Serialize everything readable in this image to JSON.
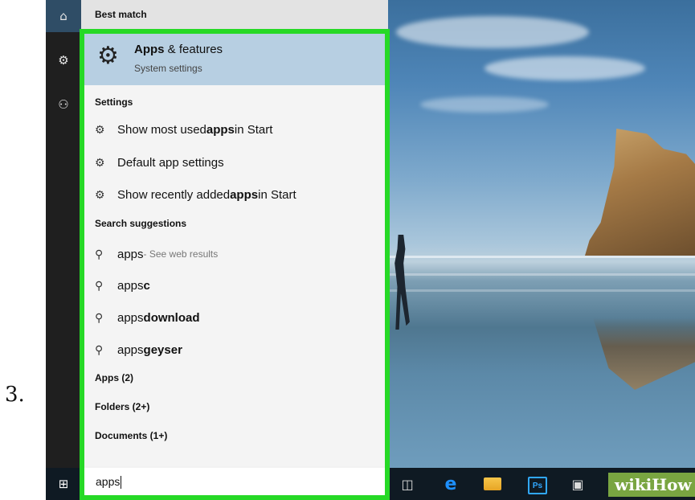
{
  "step_number": "3.",
  "panel": {
    "best_match_label": "Best match",
    "best": {
      "title_strong": "Apps",
      "title_rest": " & features",
      "subtitle": "System settings",
      "icon": "gear-icon"
    },
    "settings_label": "Settings",
    "settings_items": [
      {
        "pre": "Show most used ",
        "strong": "apps",
        "post": " in Start"
      },
      {
        "pre": "Default app settings",
        "strong": "",
        "post": ""
      },
      {
        "pre": "Show recently added ",
        "strong": "apps",
        "post": " in Start"
      }
    ],
    "suggestions_label": "Search suggestions",
    "suggestions": [
      {
        "pre": "apps",
        "strong": "",
        "hint": " - See web results"
      },
      {
        "pre": "apps",
        "strong": "c",
        "hint": ""
      },
      {
        "pre": "apps ",
        "strong": "download",
        "hint": ""
      },
      {
        "pre": "apps",
        "strong": "geyser",
        "hint": ""
      }
    ],
    "apps_label": "Apps (2)",
    "folders_label": "Folders (2+)",
    "documents_label": "Documents (1+)",
    "search_value": "apps"
  },
  "rail": {
    "items": [
      "home-icon",
      "gear-icon",
      "feedback-icon"
    ]
  },
  "taskbar": {
    "ps_label": "Ps",
    "watermark": "wikiHow"
  },
  "colors": {
    "highlight": "#26d926",
    "best_match_bg": "#b7cfe2"
  }
}
